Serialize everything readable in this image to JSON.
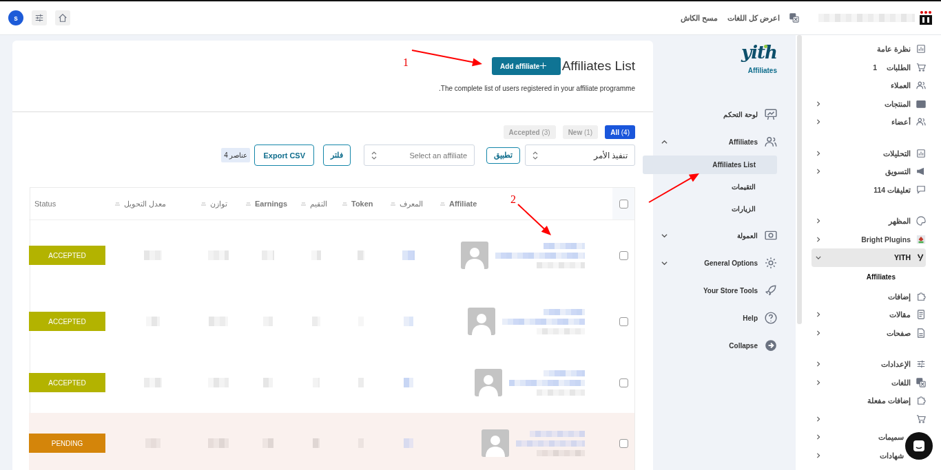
{
  "top_bar": {
    "avatar": "s",
    "links": [
      {
        "label": "اعرض كل اللغات"
      },
      {
        "label": "مسح الكاش"
      }
    ]
  },
  "sidebar": {
    "groups": [
      [
        {
          "label": "نظرة عامة",
          "expandable": false,
          "selected": false
        },
        {
          "label": "الطلبات",
          "count": "1",
          "expandable": false,
          "selected": false
        },
        {
          "label": "العملاء",
          "expandable": false,
          "selected": false
        },
        {
          "label": "المنتجات",
          "expandable": true,
          "expanded": false,
          "selected": false
        },
        {
          "label": "أعضاء",
          "expandable": true,
          "expanded": false,
          "selected": false
        }
      ],
      [
        {
          "label": "التحليلات",
          "expandable": true,
          "expanded": false,
          "selected": false
        },
        {
          "label": "التسويق",
          "expandable": true,
          "expanded": false,
          "selected": false
        },
        {
          "label": "تعليقات 114",
          "expandable": false,
          "selected": false
        }
      ],
      [
        {
          "label": "المظهر",
          "expandable": true,
          "expanded": false,
          "selected": false
        },
        {
          "label": "Bright Plugins",
          "expandable": true,
          "expanded": false,
          "selected": false
        },
        {
          "label": "YITH",
          "expandable": true,
          "expanded": true,
          "selected": true,
          "children": [
            {
              "label": "Affiliates",
              "selected": true
            }
          ]
        },
        {
          "label": "إضافات",
          "expandable": false,
          "selected": false
        },
        {
          "label": "مقالات",
          "expandable": true,
          "expanded": false,
          "selected": false
        },
        {
          "label": "صفحات",
          "expandable": true,
          "expanded": false,
          "selected": false
        }
      ],
      [
        {
          "label": "الإعدادات",
          "expandable": true,
          "expanded": false,
          "selected": false
        },
        {
          "label": "اللغات",
          "expandable": true,
          "expanded": false,
          "selected": false
        },
        {
          "label": "إضافات مفعلة",
          "expandable": false,
          "selected": false
        },
        {
          "expandable": true,
          "expanded": false,
          "selected": false
        },
        {
          "label": "سميمات",
          "expandable": true,
          "expanded": false,
          "selected": false
        },
        {
          "label": "شهادات",
          "expandable": true,
          "expanded": false,
          "selected": false
        }
      ]
    ]
  },
  "plugin_nav": {
    "logo": "yith",
    "subtitle": "Affiliates",
    "items": [
      {
        "label": "لوحة التحكم",
        "expandable": false
      },
      {
        "label": "Affiliates",
        "expandable": true,
        "expanded": true,
        "children": [
          {
            "label": "Affiliates List",
            "selected": true
          },
          {
            "label": "التقيمات",
            "selected": false
          },
          {
            "label": "الزيارات",
            "selected": false
          }
        ]
      },
      {
        "label": "العمولة",
        "expandable": true,
        "expanded": false
      },
      {
        "label": "General Options",
        "expandable": true,
        "expanded": false
      },
      {
        "label": "Your Store Tools",
        "expandable": false
      },
      {
        "label": "Help",
        "expandable": false
      },
      {
        "label": "Collapse",
        "expandable": false
      }
    ]
  },
  "page": {
    "title": "Affiliates List",
    "add_button": "Add affiliate",
    "description": ".The complete list of users registered in your affiliate programme",
    "tabs": [
      {
        "label": "All",
        "count": "(4)",
        "selected": true
      },
      {
        "label": "New",
        "count": "(1)",
        "selected": false
      },
      {
        "label": "Accepted",
        "count": "(3)",
        "selected": false
      }
    ],
    "bulk_action": {
      "value": "تنفيذ الأمر"
    },
    "apply_button": "تطبيق",
    "affiliate_select": {
      "placeholder": "Select an affiliate"
    },
    "filter_button": "فلتر",
    "export_button": "Export CSV",
    "item_count": "4 عناصر"
  },
  "table": {
    "select_all_checked": false,
    "columns": [
      {
        "label": "Affiliate",
        "bold": true
      },
      {
        "label": "المعرف",
        "bold": false
      },
      {
        "label": "Token",
        "bold": true
      },
      {
        "label": "التقيم",
        "bold": false
      },
      {
        "label": "Earnings",
        "bold": true
      },
      {
        "label": "توازن",
        "bold": false
      },
      {
        "label": "معدل التحويل",
        "bold": false
      },
      {
        "label": "Status",
        "bold": false
      }
    ],
    "rows": [
      {
        "checked": false,
        "highlighted": false,
        "status": {
          "label": "ACCEPTED",
          "color": "#b3b300"
        }
      },
      {
        "checked": false,
        "highlighted": false,
        "status": {
          "label": "ACCEPTED",
          "color": "#b3b300"
        }
      },
      {
        "checked": false,
        "highlighted": false,
        "status": {
          "label": "ACCEPTED",
          "color": "#b3b300"
        }
      },
      {
        "checked": false,
        "highlighted": true,
        "status": {
          "label": "PENDING",
          "color": "#d4850a"
        }
      }
    ]
  },
  "annotations": [
    {
      "kind": "arrow",
      "label": "1"
    },
    {
      "kind": "arrow",
      "label": "2"
    },
    {
      "kind": "arrow"
    }
  ]
}
